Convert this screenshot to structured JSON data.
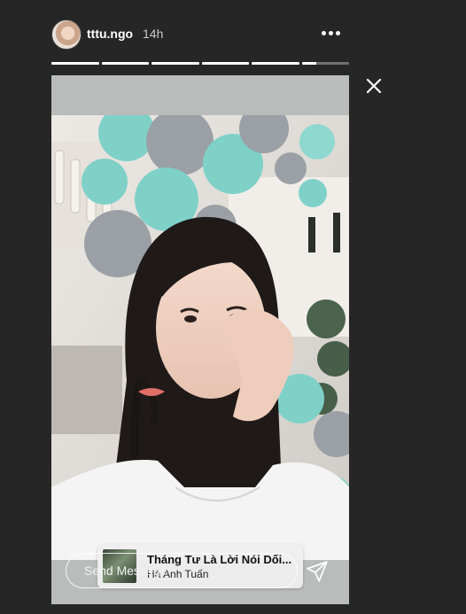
{
  "header": {
    "username": "tttu.ngo",
    "timestamp": "14h",
    "icons": {
      "more": "more-horizontal-icon",
      "close": "close-icon"
    }
  },
  "progress": {
    "segments": 6,
    "completed": 5,
    "current_fraction": 0.3
  },
  "music_sticker": {
    "title": "Tháng Tư Là Lời Nói Dối...",
    "artist": "Hà Anh Tuấn"
  },
  "reply": {
    "placeholder": "Send Message"
  },
  "colors": {
    "background": "#262626",
    "progress_fill": "#ffffff",
    "balloon_teal": "#7fd1c8",
    "balloon_grey": "#9aa0a5"
  }
}
